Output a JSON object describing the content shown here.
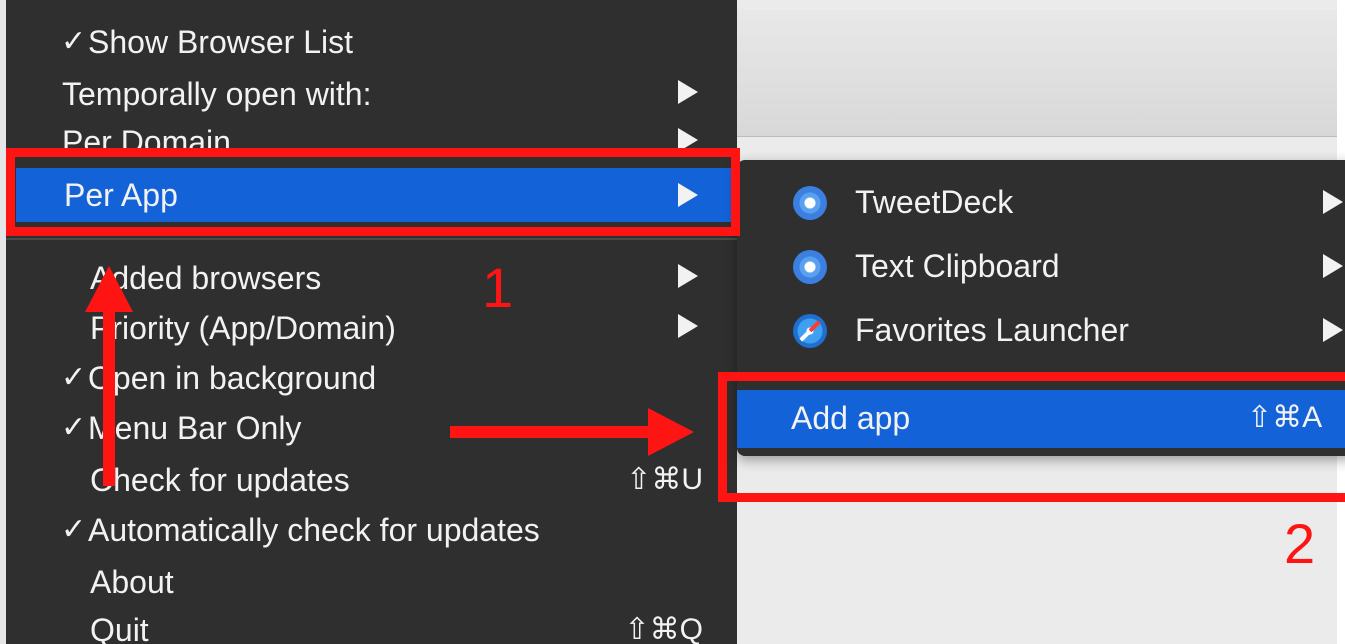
{
  "main_menu": {
    "items": [
      {
        "check": "✓",
        "label": "Show Browser List",
        "shortcut": ""
      },
      {
        "check": "",
        "label": "Temporally open with:",
        "shortcut": ""
      },
      {
        "check": "",
        "label": "Per Domain",
        "shortcut": ""
      },
      {
        "check": "",
        "label": "Per App",
        "shortcut": ""
      },
      {
        "check": "",
        "label": "Added browsers",
        "shortcut": ""
      },
      {
        "check": "",
        "label": "Priority (App/Domain)",
        "shortcut": ""
      },
      {
        "check": "✓",
        "label": "Open in background",
        "shortcut": ""
      },
      {
        "check": "✓",
        "label": "Menu Bar Only",
        "shortcut": ""
      },
      {
        "check": "",
        "label": "Check for updates",
        "shortcut": "⇧⌘U"
      },
      {
        "check": "✓",
        "label": "Automatically check for updates",
        "shortcut": ""
      },
      {
        "check": "",
        "label": "About",
        "shortcut": ""
      },
      {
        "check": "",
        "label": "Quit",
        "shortcut": "⇧⌘Q"
      }
    ],
    "selected_label": "Per App"
  },
  "sub_menu": {
    "items": [
      {
        "label": "TweetDeck",
        "icon": "chrome-app-icon"
      },
      {
        "label": "Text Clipboard",
        "icon": "chrome-app-icon"
      },
      {
        "label": "Favorites Launcher",
        "icon": "safari-app-icon"
      }
    ],
    "add_app": {
      "label": "Add app",
      "shortcut": "⇧⌘A"
    }
  },
  "annotations": {
    "step1": "1",
    "step2": "2",
    "color": "#ff1414"
  },
  "colors": {
    "menu_bg": "#2f2f2f",
    "selection": "#1462d8",
    "text": "#f2f2f2"
  }
}
